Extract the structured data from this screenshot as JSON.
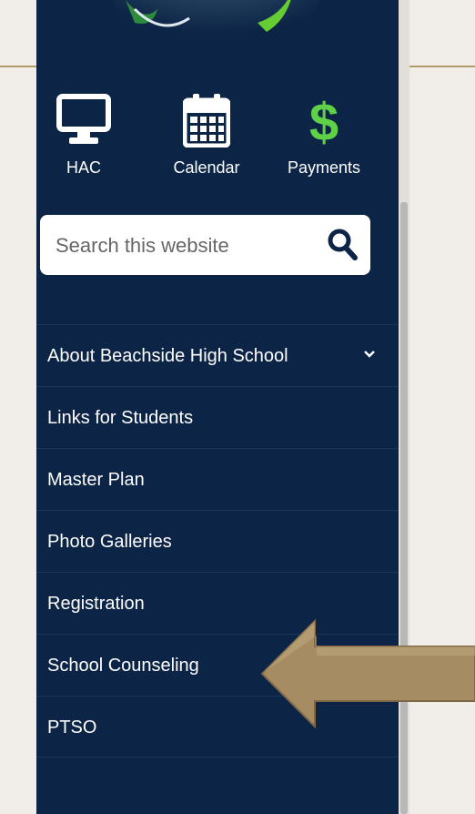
{
  "quick_links": [
    {
      "label": "HAC",
      "icon": "monitor-icon"
    },
    {
      "label": "Calendar",
      "icon": "calendar-icon"
    },
    {
      "label": "Payments",
      "icon": "dollar-sign-icon"
    }
  ],
  "search": {
    "placeholder": "Search this website",
    "icon": "search-icon"
  },
  "nav": [
    {
      "label": "About Beachside High School",
      "icon": "chevron-down-icon"
    },
    {
      "label": "Links for Students"
    },
    {
      "label": "Master Plan"
    },
    {
      "label": "Photo Galleries"
    },
    {
      "label": "Registration"
    },
    {
      "label": "School Counseling"
    },
    {
      "label": "PTSO"
    }
  ],
  "colors": {
    "sidebar": "#0c2446",
    "payments_icon": "#5ed146",
    "arrow": "#a58c63",
    "page_background": "#f1eeea"
  }
}
